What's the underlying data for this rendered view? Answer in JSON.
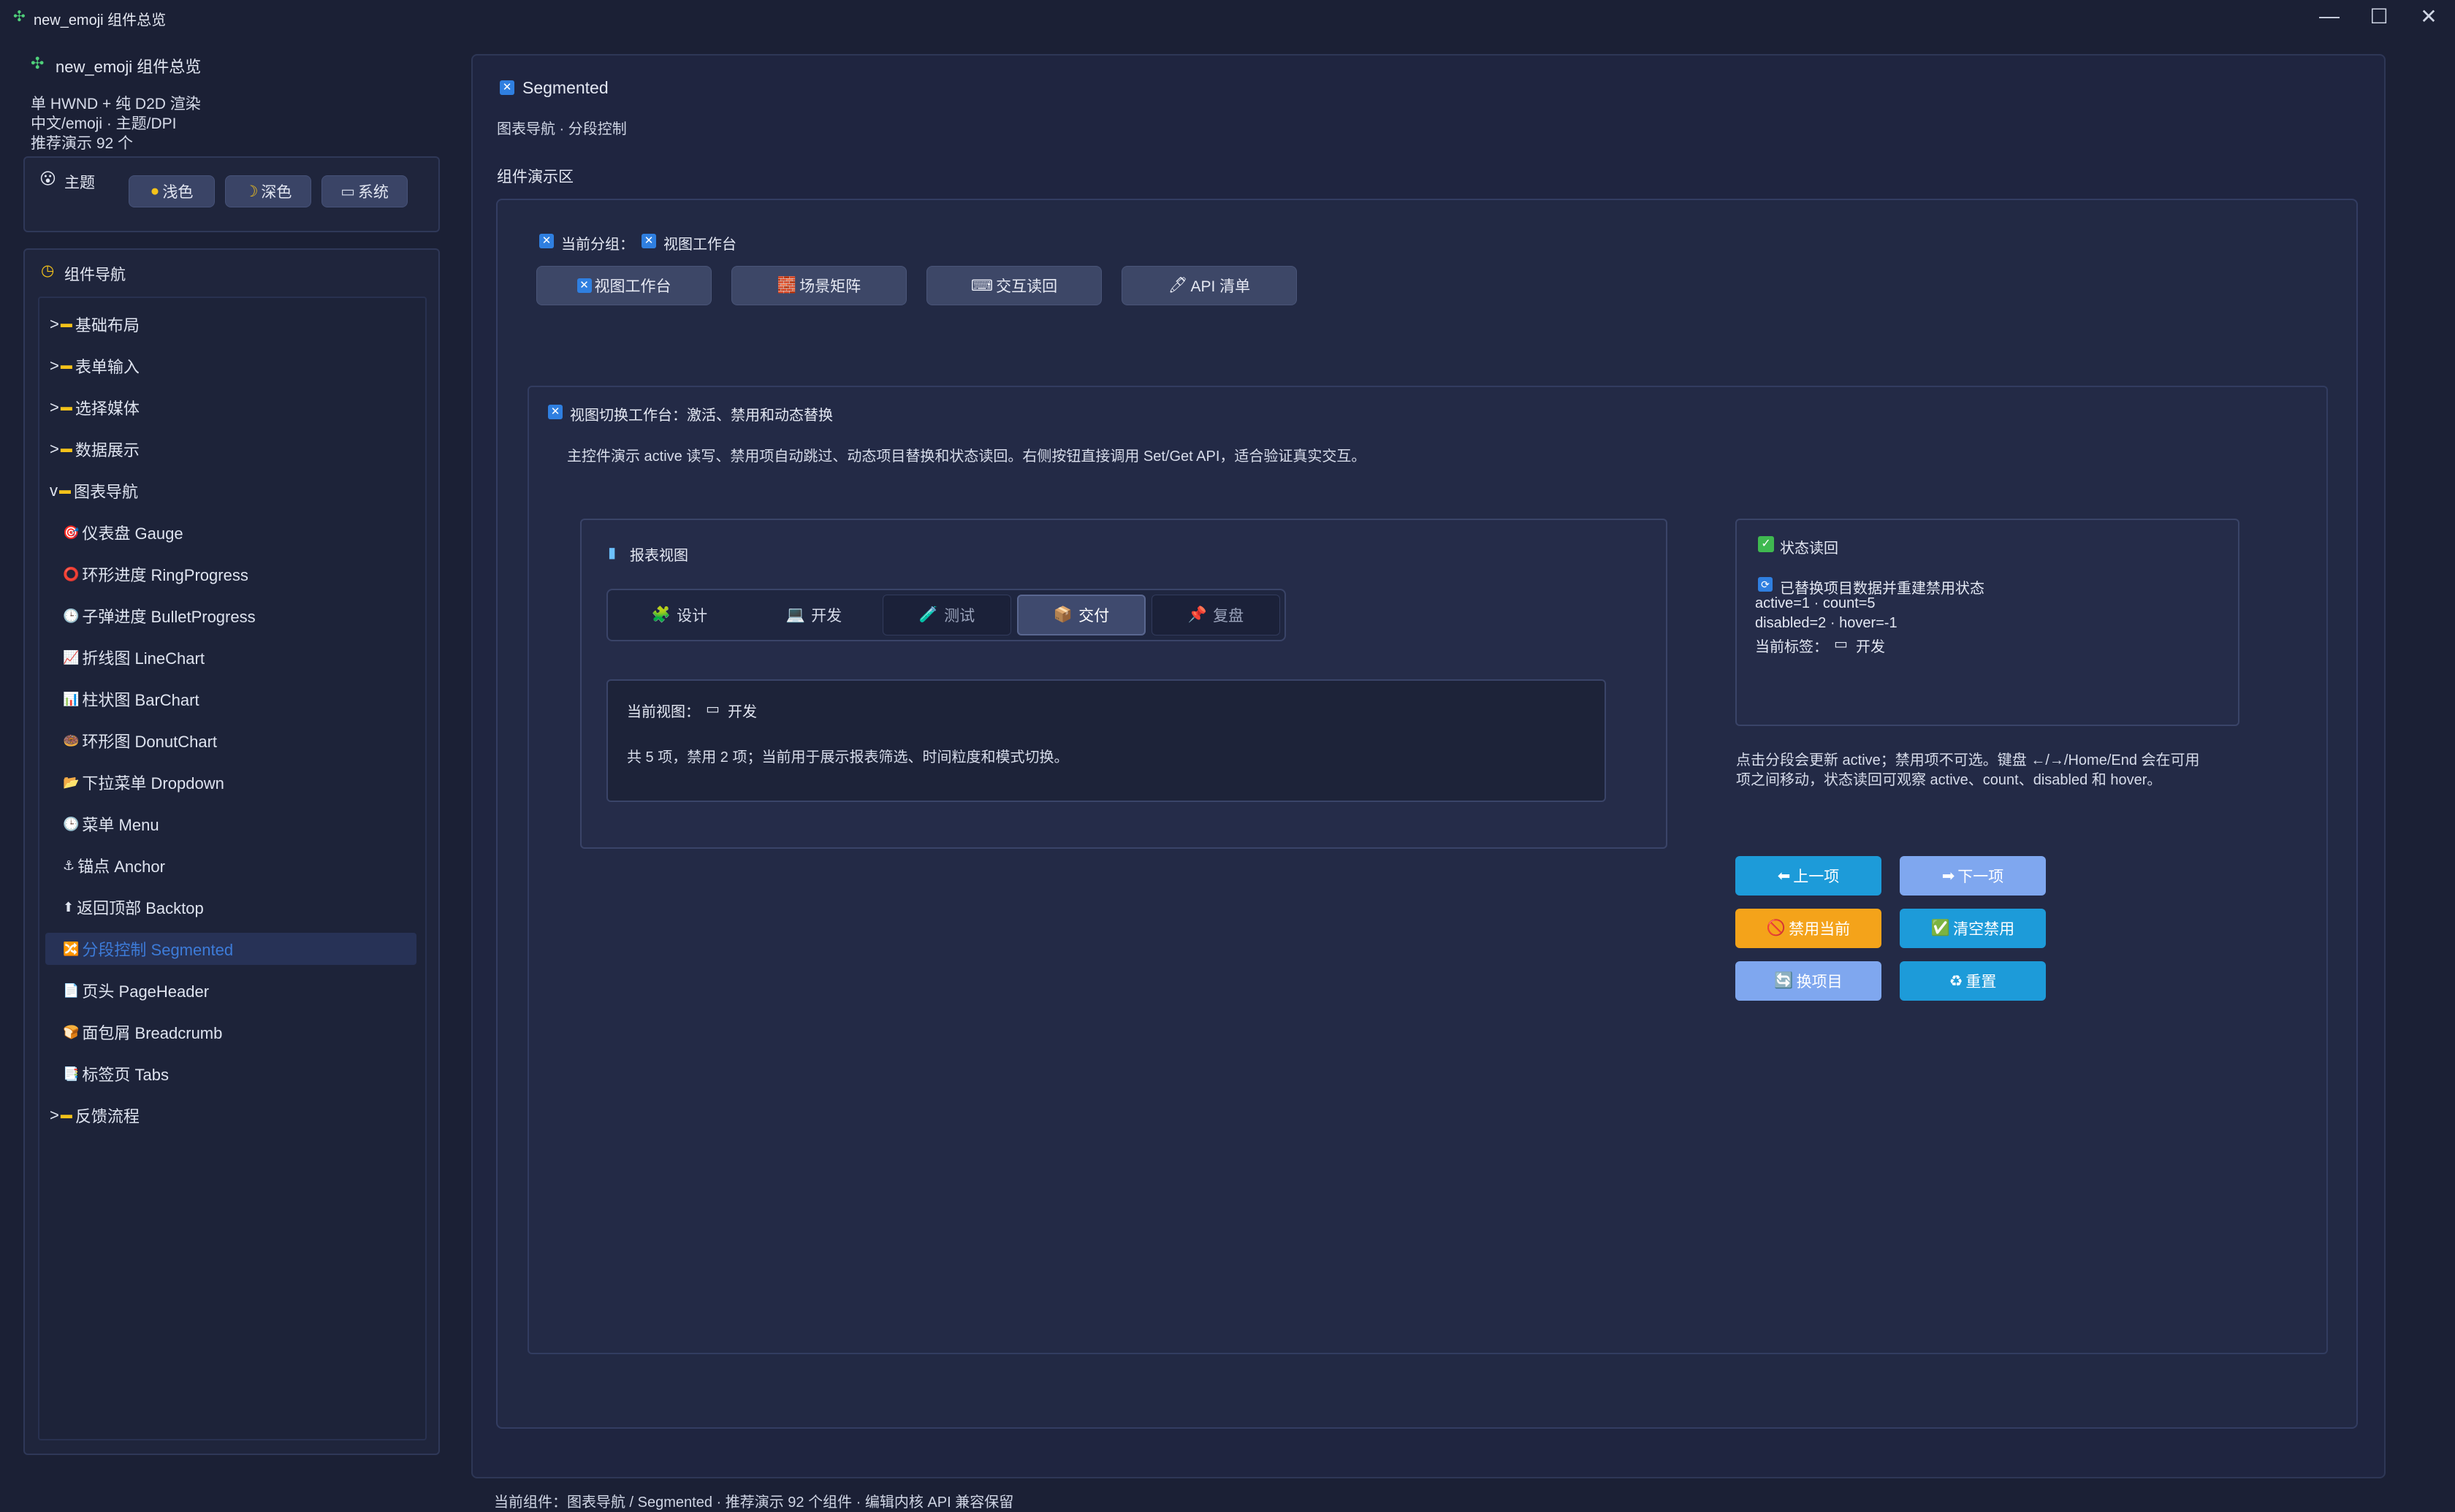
{
  "window": {
    "title": "new_emoji 组件总览",
    "controls": [
      "—",
      "☐",
      "✕"
    ]
  },
  "sidebar": {
    "app_title": "new_emoji 组件总览",
    "info": [
      "单 HWND + 纯 D2D 渲染",
      "中文/emoji · 主题/DPI",
      "推荐演示 92 个"
    ],
    "theme": {
      "label": "主题",
      "buttons": [
        "浅色",
        "深色",
        "系统"
      ]
    },
    "nav_title": "组件导航",
    "nav_items": [
      {
        "label": "基础布局",
        "prefix": ">",
        "folder": true
      },
      {
        "label": "表单输入",
        "prefix": ">",
        "folder": true
      },
      {
        "label": "选择媒体",
        "prefix": ">",
        "folder": true
      },
      {
        "label": "数据展示",
        "prefix": ">",
        "folder": true
      },
      {
        "label": "图表导航",
        "prefix": "v",
        "folder": true
      },
      {
        "label": "仪表盘 Gauge",
        "icon": "🎯"
      },
      {
        "label": "环形进度 RingProgress",
        "icon": "⭕"
      },
      {
        "label": "子弹进度 BulletProgress",
        "icon": "🕒"
      },
      {
        "label": "折线图 LineChart",
        "icon": "📈"
      },
      {
        "label": "柱状图 BarChart",
        "icon": "📊"
      },
      {
        "label": "环形图 DonutChart",
        "icon": "🍩"
      },
      {
        "label": "下拉菜单 Dropdown",
        "icon": "📂"
      },
      {
        "label": "菜单 Menu",
        "icon": "🕒"
      },
      {
        "label": "锚点 Anchor",
        "icon": "⚓"
      },
      {
        "label": "返回顶部 Backtop",
        "icon": "⬆"
      },
      {
        "label": "分段控制 Segmented",
        "icon": "🔀",
        "active": true
      },
      {
        "label": "页头 PageHeader",
        "icon": "📄"
      },
      {
        "label": "面包屑 Breadcrumb",
        "icon": "🍞"
      },
      {
        "label": "标签页 Tabs",
        "icon": "📑"
      },
      {
        "label": "反馈流程",
        "prefix": ">",
        "folder": true
      }
    ]
  },
  "main": {
    "title": "Segmented",
    "subtitle": "图表导航 · 分段控制",
    "demo_label": "组件演示区",
    "current_group_prefix": "当前分组：",
    "current_group": "视图工作台",
    "group_tabs": [
      {
        "icon": "🔀",
        "label": "视图工作台"
      },
      {
        "icon": "🧱",
        "label": "场景矩阵"
      },
      {
        "icon": "⌨",
        "label": "交互读回"
      },
      {
        "icon": "🖊",
        "label": "API 清单"
      }
    ],
    "section_title": "视图切换工作台：激活、禁用和动态替换",
    "section_desc": "主控件演示 active 读写、禁用项自动跳过、动态项目替换和状态读回。右侧按钮直接调用 Set/Get API，适合验证真实交互。",
    "report": {
      "title": "报表视图",
      "options": [
        {
          "icon": "🧩",
          "label": "设计",
          "state": "normal"
        },
        {
          "icon": "💻",
          "label": "开发",
          "state": "normal"
        },
        {
          "icon": "🧪",
          "label": "测试",
          "state": "disabled"
        },
        {
          "icon": "📦",
          "label": "交付",
          "state": "active"
        },
        {
          "icon": "📌",
          "label": "复盘",
          "state": "disabled"
        }
      ],
      "current_view_prefix": "当前视图：",
      "current_view": "开发",
      "summary": "共 5 项，禁用 2 项；当前用于展示报表筛选、时间粒度和模式切换。"
    },
    "status": {
      "title": "状态读回",
      "line1": "已替换项目数据并重建禁用状态",
      "line2": "active=1 · count=5",
      "line3": "disabled=2 · hover=-1",
      "line4_prefix": "当前标签：",
      "line4_value": "开发"
    },
    "hint": [
      "点击分段会更新 active；禁用项不可选。键盘 ←/→/Home/End 会在可用",
      "项之间移动，状态读回可观察 active、count、disabled 和 hover。"
    ],
    "actions": [
      {
        "icon": "⬅",
        "label": "上一项"
      },
      {
        "icon": "➡",
        "label": "下一项"
      },
      {
        "icon": "🚫",
        "label": "禁用当前"
      },
      {
        "icon": "✅",
        "label": "清空禁用"
      },
      {
        "icon": "🔄",
        "label": "换项目"
      },
      {
        "icon": "♻",
        "label": "重置"
      }
    ]
  },
  "footer": "当前组件：图表导航 / Segmented · 推荐演示 92 个组件 · 编辑内核 API 兼容保留",
  "colors": {
    "background": "#1b2035",
    "accent_blue": "#1d9bd9",
    "light_blue": "#7fa7ef",
    "orange": "#f4a31a",
    "active_nav_text": "#3d7bd8"
  }
}
